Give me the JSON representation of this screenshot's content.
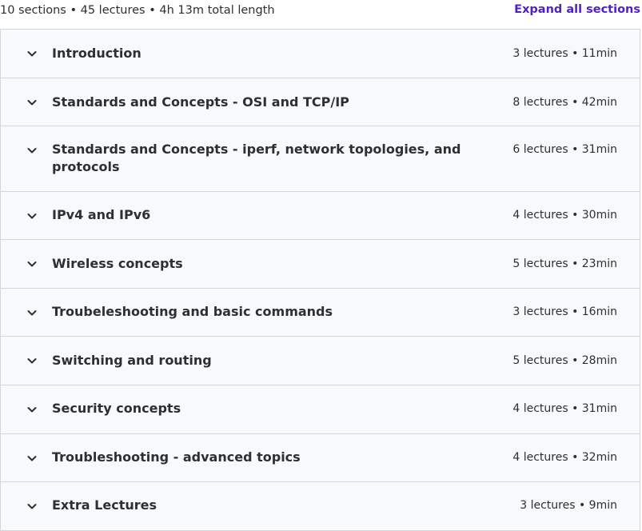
{
  "header": {
    "summary": "10 sections • 45 lectures • 4h 13m total length",
    "expand_all_label": "Expand all sections"
  },
  "sections": [
    {
      "title": "Introduction",
      "meta": "3 lectures • 11min"
    },
    {
      "title": "Standards and Concepts - OSI and TCP/IP",
      "meta": "8 lectures • 42min"
    },
    {
      "title": "Standards and Concepts - iperf, network topologies, and protocols",
      "meta": "6 lectures • 31min"
    },
    {
      "title": "IPv4 and IPv6",
      "meta": "4 lectures • 30min"
    },
    {
      "title": "Wireless concepts",
      "meta": "5 lectures • 23min"
    },
    {
      "title": "Troubeleshooting and basic commands",
      "meta": "3 lectures • 16min"
    },
    {
      "title": "Switching and routing",
      "meta": "5 lectures • 28min"
    },
    {
      "title": "Security concepts",
      "meta": "4 lectures • 31min"
    },
    {
      "title": "Troubleshooting - advanced topics",
      "meta": "4 lectures • 32min"
    },
    {
      "title": "Extra Lectures",
      "meta": "3 lectures • 9min"
    }
  ],
  "icons": {
    "section_toggle": "chevron-down-icon"
  },
  "colors": {
    "accent": "#5022c3",
    "panel_bg": "#f7f9fa",
    "border": "#d1d7dc",
    "text": "#2d2f31"
  }
}
